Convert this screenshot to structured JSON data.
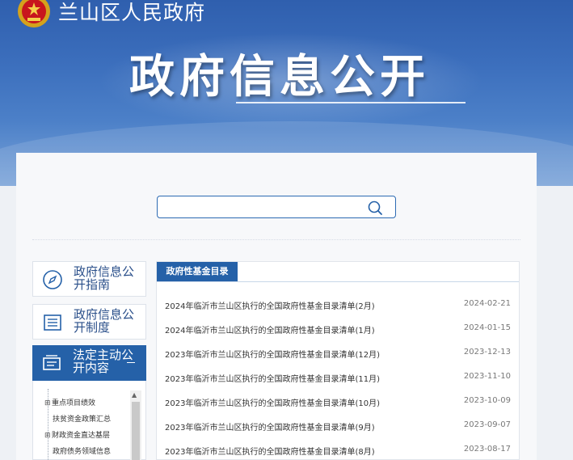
{
  "header": {
    "site_name": "兰山区人民政府",
    "banner_title": "政府信息公开"
  },
  "search": {
    "placeholder": ""
  },
  "sidebar": {
    "cards": [
      {
        "label": "政府信息公开指南"
      },
      {
        "label": "政府信息公开制度"
      },
      {
        "label": "法定主动公开内容",
        "active_marker": "—"
      }
    ],
    "tree": [
      {
        "prefix": "⊞",
        "label": "重点项目绩效"
      },
      {
        "prefix": "",
        "label": "扶贫资金政策汇总"
      },
      {
        "prefix": "⊞",
        "label": "财政资金直达基层"
      },
      {
        "prefix": "",
        "label": "政府债务领域信息"
      }
    ]
  },
  "content": {
    "tab_label": "政府性基金目录",
    "items": [
      {
        "title": "2024年临沂市兰山区执行的全国政府性基金目录清单(2月)",
        "date": "2024-02-21"
      },
      {
        "title": "2024年临沂市兰山区执行的全国政府性基金目录清单(1月)",
        "date": "2024-01-15"
      },
      {
        "title": "2023年临沂市兰山区执行的全国政府性基金目录清单(12月)",
        "date": "2023-12-13"
      },
      {
        "title": "2023年临沂市兰山区执行的全国政府性基金目录清单(11月)",
        "date": "2023-11-10"
      },
      {
        "title": "2023年临沂市兰山区执行的全国政府性基金目录清单(10月)",
        "date": "2023-10-09"
      },
      {
        "title": "2023年临沂市兰山区执行的全国政府性基金目录清单(9月)",
        "date": "2023-09-07"
      },
      {
        "title": "2023年临沂市兰山区执行的全国政府性基金目录清单(8月)",
        "date": "2023-08-17"
      }
    ]
  },
  "colors": {
    "primary": "#2561a8",
    "banner_top": "#2f5fae",
    "text_dark": "#333333"
  }
}
